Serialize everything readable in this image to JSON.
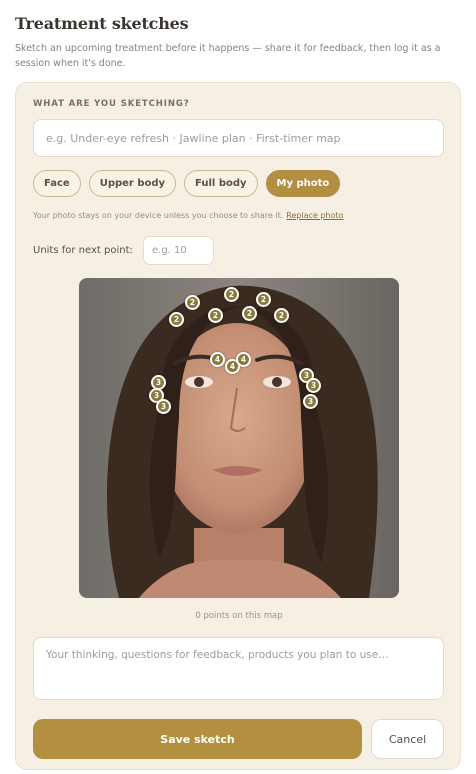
{
  "header": {
    "title": "Treatment sketches",
    "subtitle": "Sketch an upcoming treatment before it happens — share it for feedback, then log it as a session when it's done."
  },
  "form": {
    "section_label": "WHAT ARE YOU SKETCHING?",
    "what_placeholder": "e.g. Under-eye refresh · Jawline plan · First-timer map",
    "chips": [
      {
        "label": "Face",
        "active": false
      },
      {
        "label": "Upper body",
        "active": false
      },
      {
        "label": "Full body",
        "active": false
      },
      {
        "label": "My photo",
        "active": true
      }
    ],
    "privacy_text": "Your photo stays on your device unless you choose to share it.",
    "replace_link": "Replace photo",
    "units_label": "Units for next point:",
    "units_placeholder": "e.g. 10",
    "points_count": "0 points on this map",
    "notes_placeholder": "Your thinking, questions for feedback, products you plan to use…",
    "save_label": "Save sketch",
    "cancel_label": "Cancel"
  },
  "markers": [
    "2",
    "2",
    "2",
    "2",
    "2",
    "2",
    "2",
    "4",
    "4",
    "4",
    "3",
    "3",
    "3",
    "3",
    "3",
    "3"
  ],
  "colors": {
    "accent": "#b3903f",
    "card_bg": "#f6efe4",
    "marker": "#8c7a3c"
  }
}
